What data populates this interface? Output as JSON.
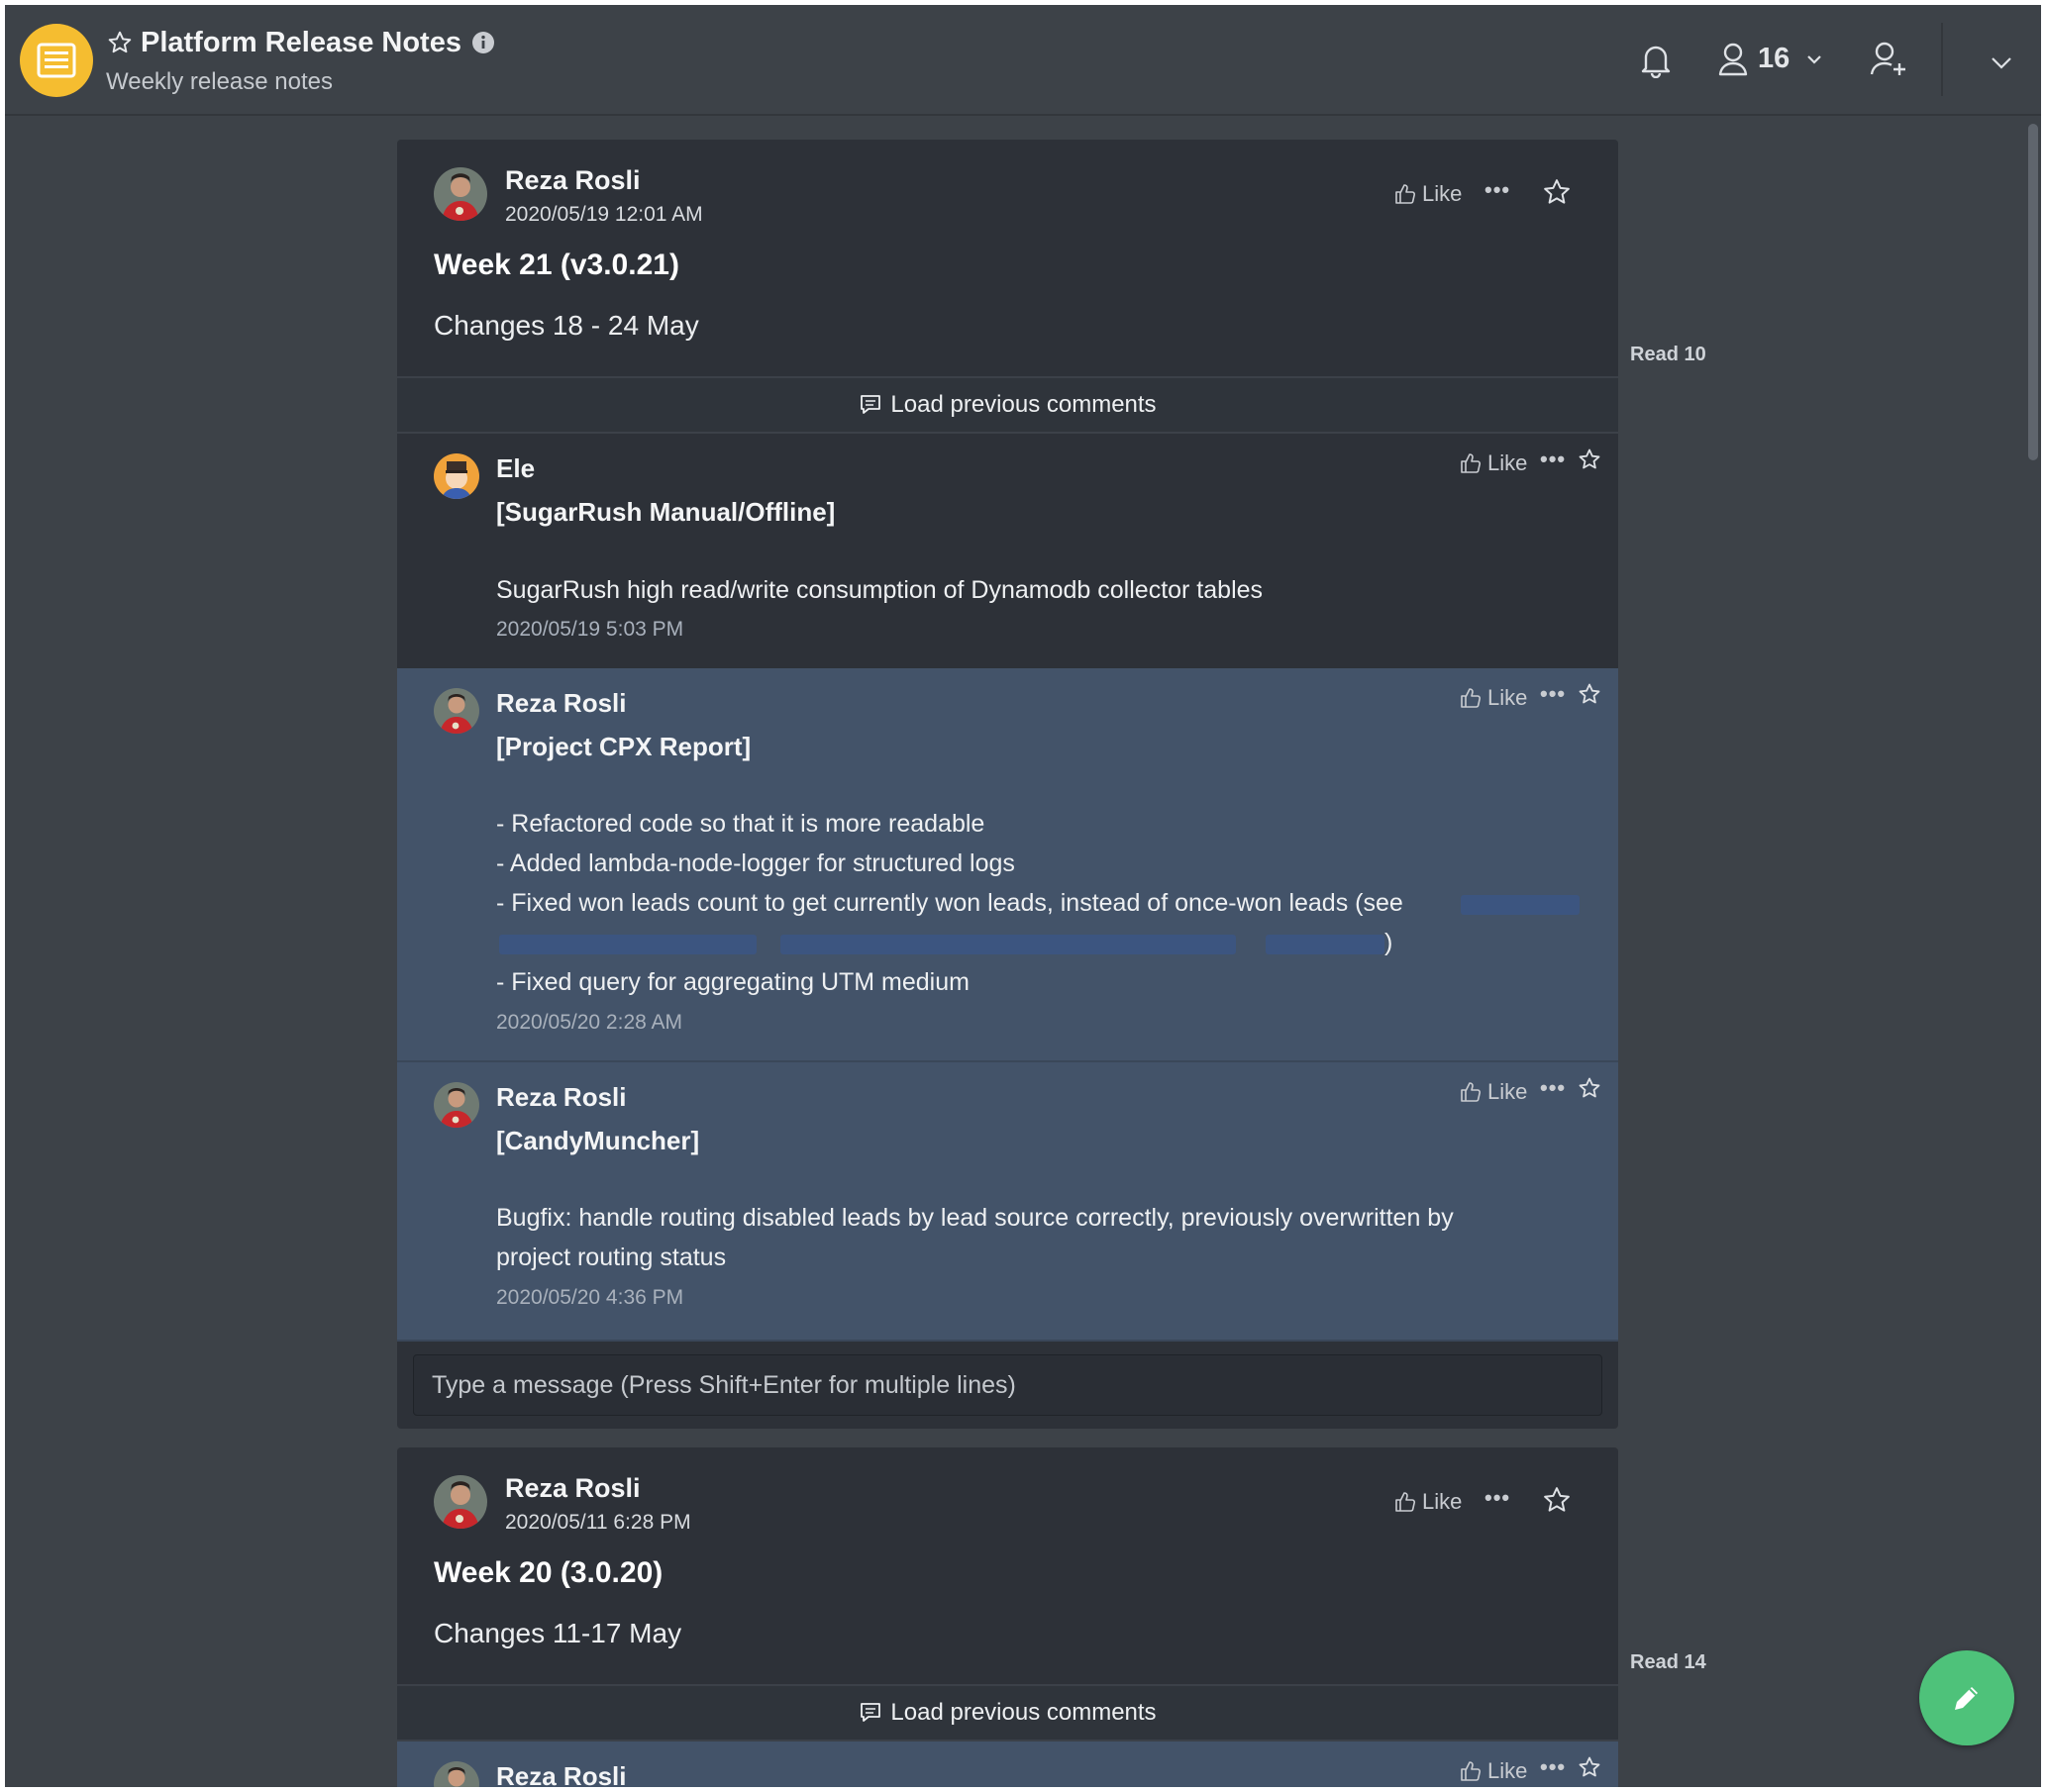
{
  "header": {
    "title": "Platform Release Notes",
    "subtitle": "Weekly release notes",
    "member_count": "16"
  },
  "posts": [
    {
      "author": "Reza Rosli",
      "date": "2020/05/19 12:01 AM",
      "title": "Week 21 (v3.0.21)",
      "body": "Changes 18 - 24 May",
      "like_label": "Like",
      "read_label": "Read 10",
      "load_previous": "Load previous comments",
      "comments": [
        {
          "author": "Ele",
          "tag": "[SugarRush Manual/Offline]",
          "lines": [
            "SugarRush high read/write consumption of Dynamodb collector tables"
          ],
          "time": "2020/05/19 5:03 PM",
          "like_label": "Like"
        },
        {
          "author": "Reza Rosli",
          "tag": "[Project CPX Report]",
          "lines": [
            "-  Refactored code so  that it is more readable",
            "- Added lambda-node-logger for  structured logs",
            "- Fixed won leads count to get currently won leads, instead of once-won leads (see",
            ")",
            "- Fixed query for aggregating UTM medium"
          ],
          "time": "2020/05/20 2:28 AM",
          "like_label": "Like"
        },
        {
          "author": "Reza Rosli",
          "tag": "[CandyMuncher]",
          "lines": [
            "Bugfix: handle routing disabled leads by lead source correctly, previously overwritten by",
            "project routing status"
          ],
          "time": "2020/05/20 4:36 PM",
          "like_label": "Like"
        }
      ],
      "message_placeholder": "Type a message (Press Shift+Enter for multiple lines)"
    },
    {
      "author": "Reza Rosli",
      "date": "2020/05/11 6:28 PM",
      "title": "Week 20 (3.0.20)",
      "body": "Changes 11-17 May",
      "like_label": "Like",
      "read_label": "Read 14",
      "load_previous": "Load previous comments",
      "comments": [
        {
          "author": "Reza Rosli",
          "like_label": "Like"
        }
      ]
    }
  ],
  "colors": {
    "background": "#3d4248",
    "card": "#2d3138",
    "highlight_comment": "#435369",
    "logo": "#f5bd30",
    "fab": "#4ec27a"
  },
  "icons": [
    "document-icon",
    "star-icon",
    "info-icon",
    "bell-icon",
    "user-icon",
    "chevron-down-icon",
    "add-user-icon",
    "thumbs-up-icon",
    "more-icon",
    "comment-icon",
    "pencil-icon"
  ]
}
